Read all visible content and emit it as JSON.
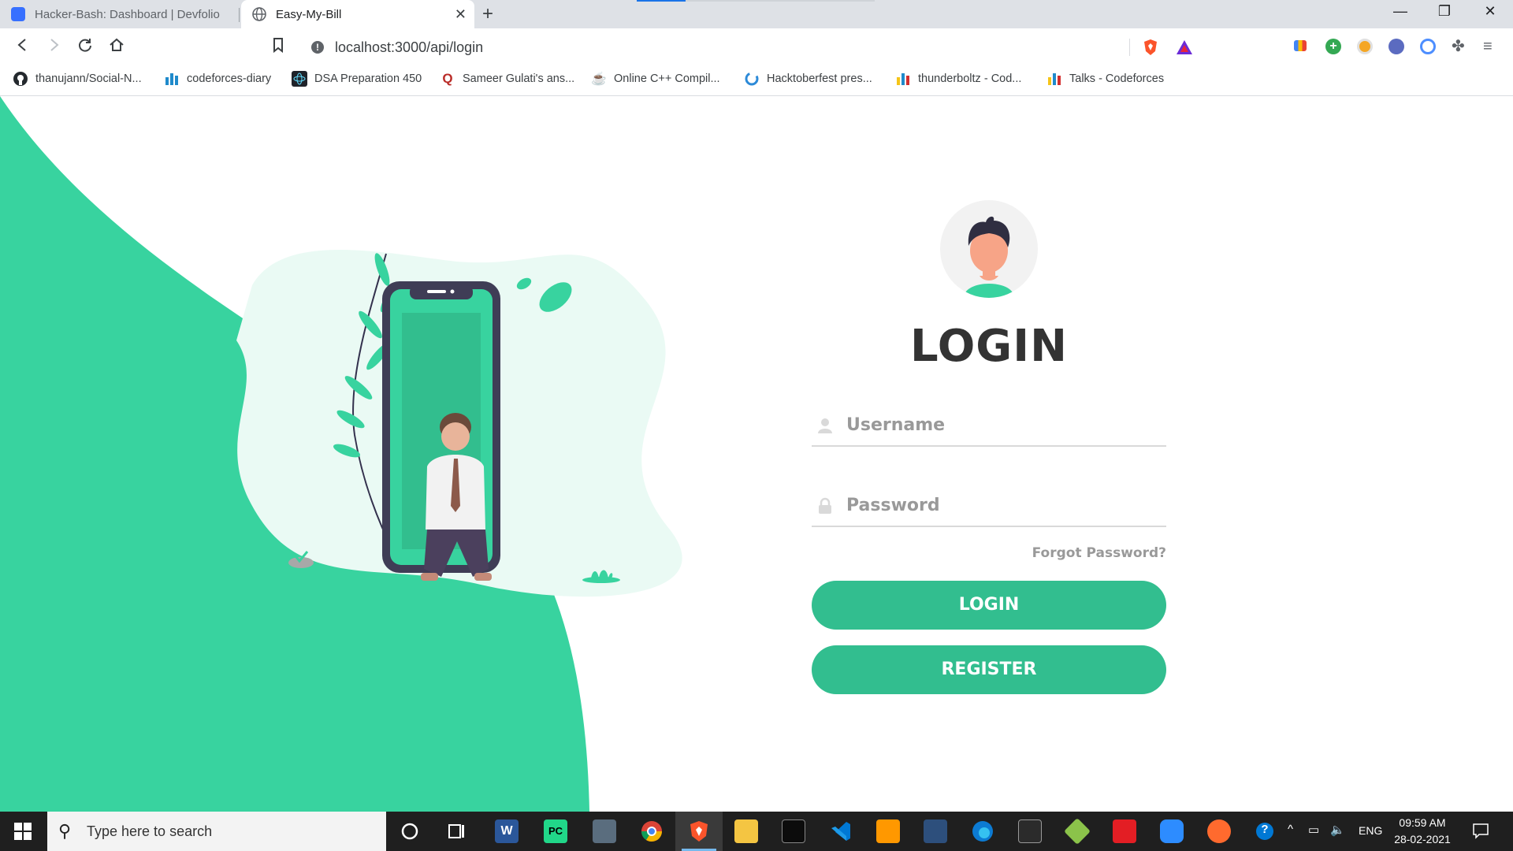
{
  "browser": {
    "tabs": [
      {
        "title": "Hacker-Bash: Dashboard | Devfolio",
        "active": false
      },
      {
        "title": "Easy-My-Bill",
        "active": true
      }
    ],
    "url": "localhost:3000/api/login",
    "bookmarks": [
      {
        "label": "thanujann/Social-N...",
        "icon": "github-icon"
      },
      {
        "label": "codeforces-diary",
        "icon": "codeforces-icon"
      },
      {
        "label": "DSA Preparation 450",
        "icon": "react-icon"
      },
      {
        "label": "Sameer Gulati's ans...",
        "icon": "quora-icon"
      },
      {
        "label": "Online C++ Compil...",
        "icon": "coffee-icon"
      },
      {
        "label": "Hacktoberfest pres...",
        "icon": "hacktoberfest-icon"
      },
      {
        "label": "thunderboltz - Cod...",
        "icon": "codeforces-icon"
      },
      {
        "label": "Talks - Codeforces",
        "icon": "codeforces-icon"
      }
    ]
  },
  "login": {
    "title": "LOGIN",
    "username_placeholder": "Username",
    "password_placeholder": "Password",
    "forgot_label": "Forgot Password?",
    "login_button": "LOGIN",
    "register_button": "REGISTER"
  },
  "colors": {
    "accent": "#32be8f",
    "wave": "#38d39f",
    "text_dark": "#333333",
    "placeholder": "#999999"
  },
  "taskbar": {
    "search_placeholder": "Type here to search",
    "language": "ENG",
    "time": "09:59 AM",
    "date": "28-02-2021"
  }
}
